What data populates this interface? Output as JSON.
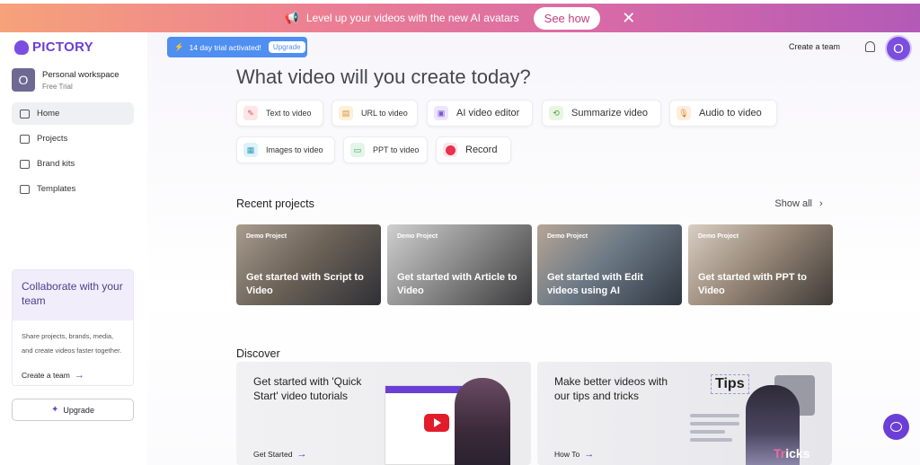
{
  "banner": {
    "text": "Level up your videos with the new AI avatars",
    "cta": "See how",
    "close": "✕"
  },
  "brand": {
    "name": "PICTORY",
    "color": "#6b3fd6"
  },
  "workspace": {
    "initial": "O",
    "name": "Personal workspace",
    "plan": "Free Trial"
  },
  "nav": [
    {
      "label": "Home",
      "icon": "home-icon",
      "active": true
    },
    {
      "label": "Projects",
      "icon": "folder-icon",
      "active": false
    },
    {
      "label": "Brand kits",
      "icon": "brand-kit-icon",
      "active": false
    },
    {
      "label": "Templates",
      "icon": "templates-icon",
      "active": false
    }
  ],
  "collab": {
    "title": "Collaborate with your team",
    "body_line1": "Share projects, brands, media,",
    "body_line2": "and create videos faster together.",
    "link": "Create a team"
  },
  "sidebar_upgrade": "Upgrade",
  "trial": {
    "text": "14 day trial activated!",
    "cta": "Upgrade"
  },
  "header": {
    "create_team": "Create a team",
    "avatar_initial": "O"
  },
  "headline": "What video will you create today?",
  "create_options": [
    {
      "label": "Text to video",
      "icon": "text-to-video-icon"
    },
    {
      "label": "URL to video",
      "icon": "url-to-video-icon"
    },
    {
      "label": "AI video editor",
      "icon": "ai-video-editor-icon"
    },
    {
      "label": "Summarize video",
      "icon": "summarize-video-icon"
    },
    {
      "label": "Audio to video",
      "icon": "audio-to-video-icon"
    },
    {
      "label": "Images to video",
      "icon": "images-to-video-icon"
    },
    {
      "label": "PPT to video",
      "icon": "ppt-to-video-icon"
    },
    {
      "label": "Record",
      "icon": "record-icon"
    }
  ],
  "recent": {
    "title": "Recent projects",
    "show_all": "Show all",
    "projects": [
      {
        "tag": "Demo Project",
        "title": "Get started with Script to Video"
      },
      {
        "tag": "Demo Project",
        "title": "Get started with Article to Video"
      },
      {
        "tag": "Demo Project",
        "title": "Get started with Edit videos using AI"
      },
      {
        "tag": "Demo Project",
        "title": "Get started with PPT to Video"
      }
    ]
  },
  "discover": {
    "title": "Discover",
    "cards": [
      {
        "title": "Get started with 'Quick Start' video tutorials",
        "link": "Get Started"
      },
      {
        "title": "Make better videos with our tips and tricks",
        "link": "How To"
      }
    ],
    "tips_label": "Tips",
    "tricks_label_a": "Tr",
    "tricks_label_b": "icks"
  }
}
